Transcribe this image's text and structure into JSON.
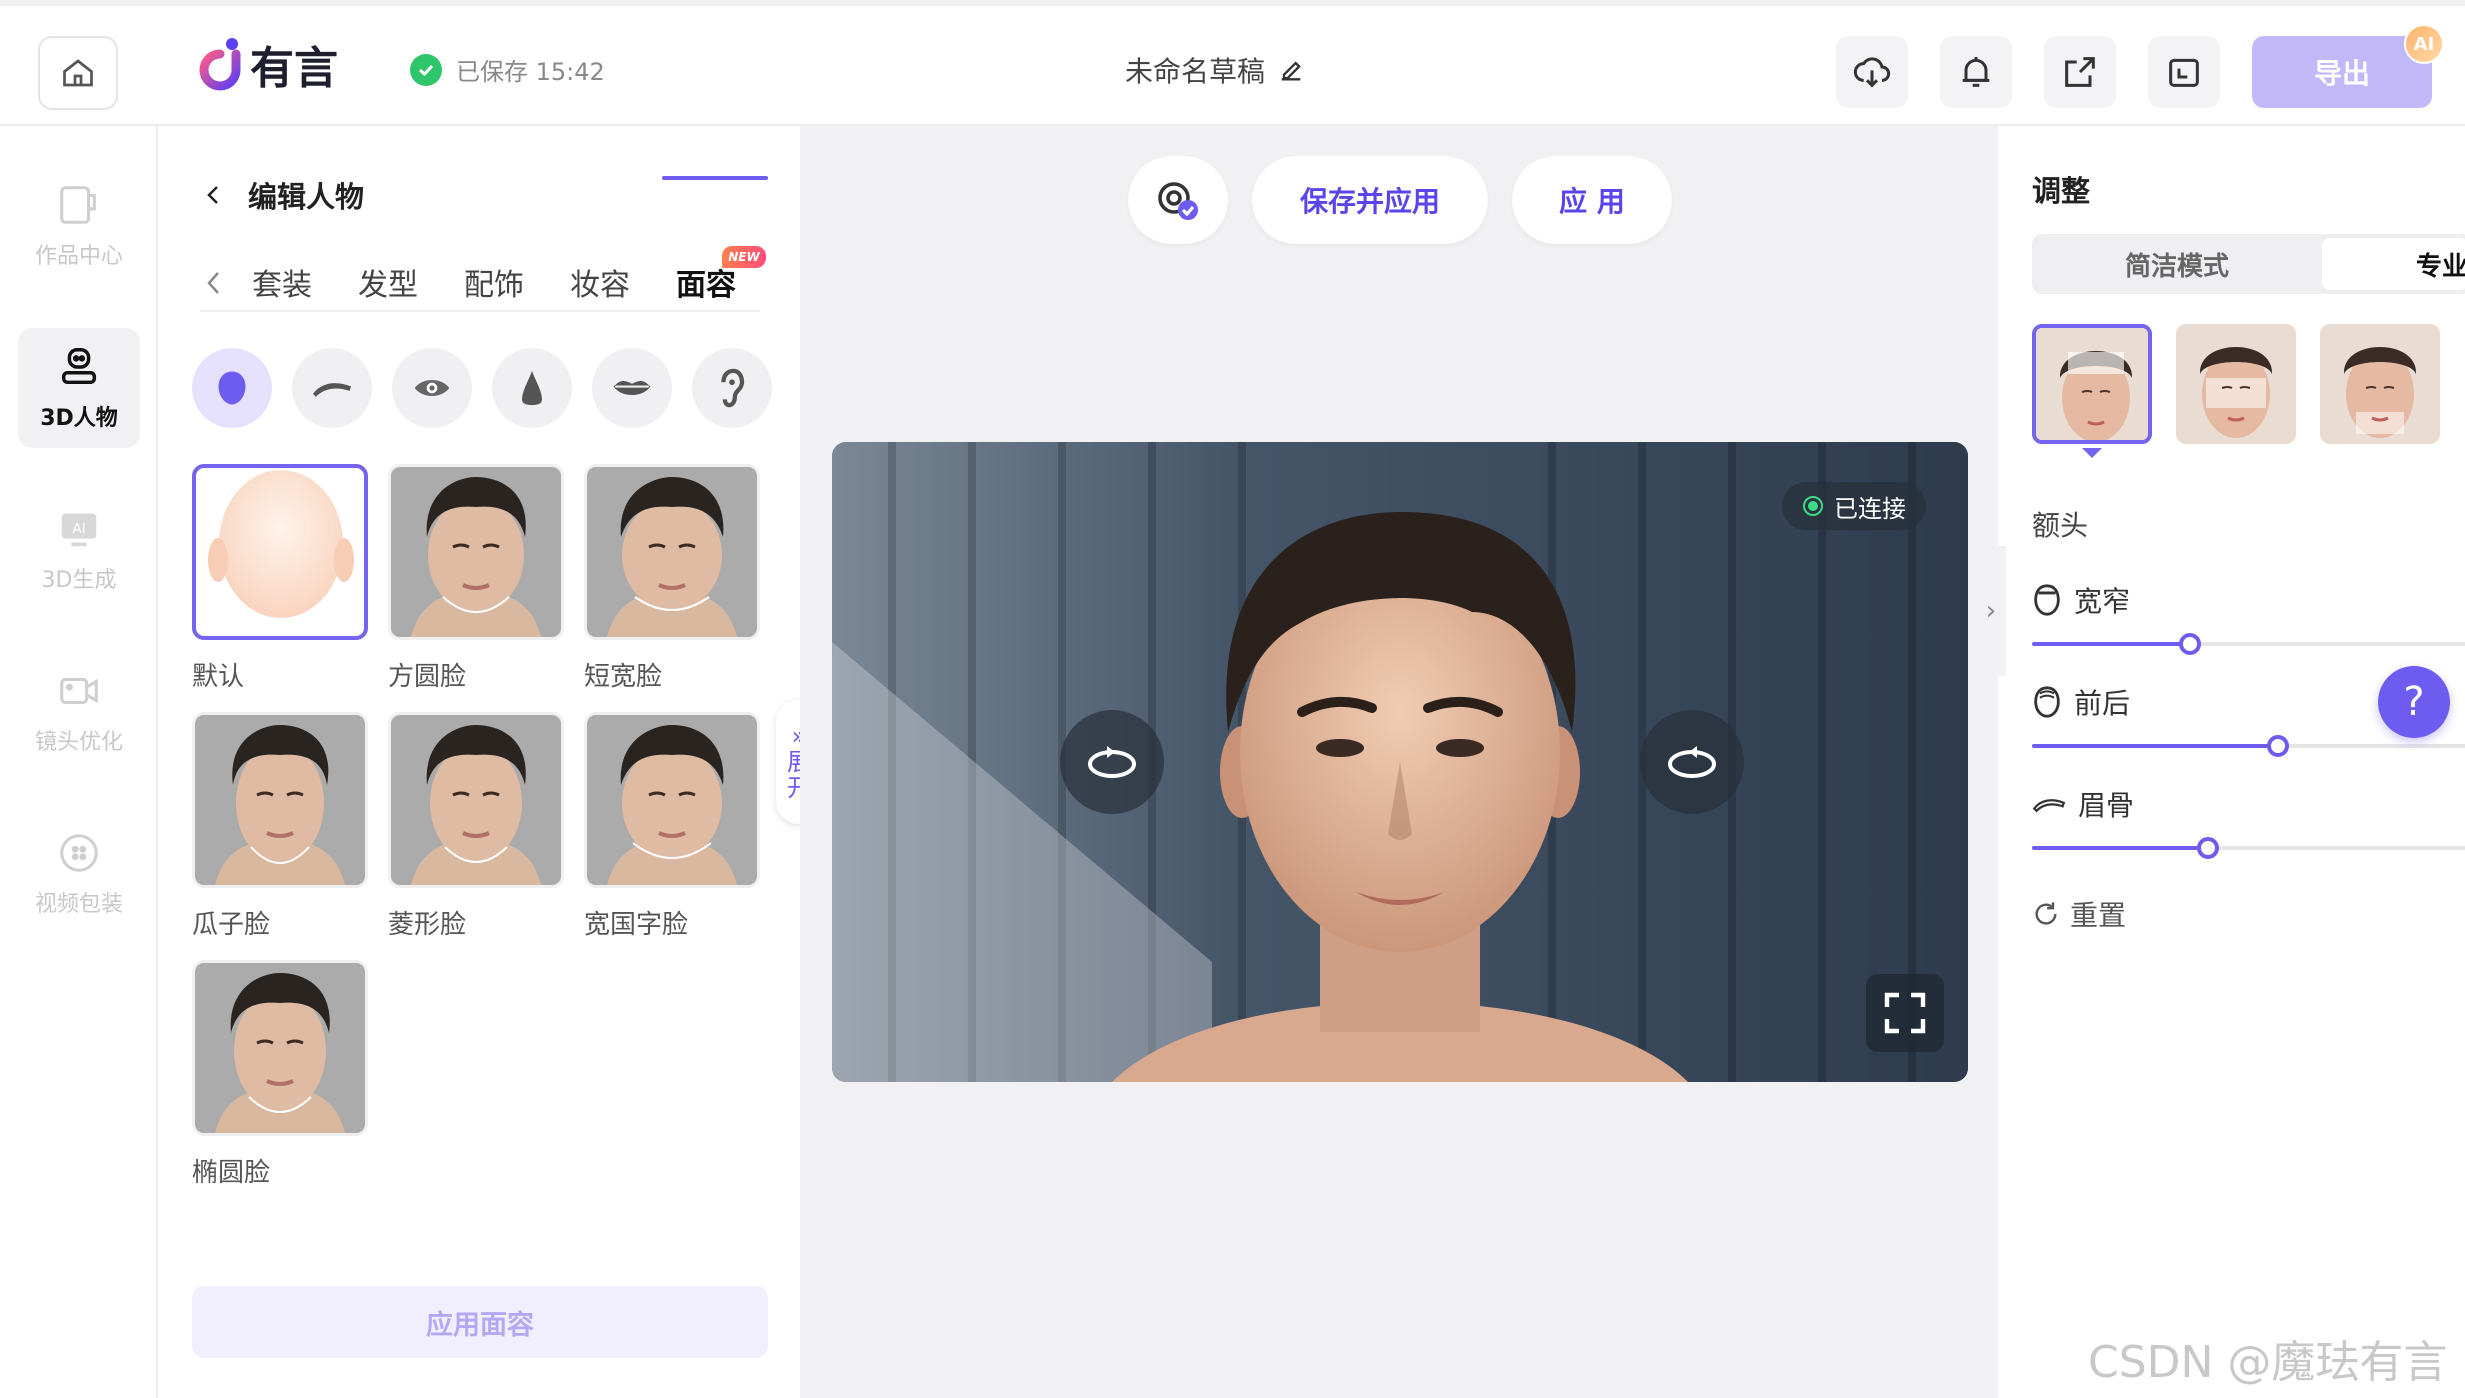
{
  "header": {
    "logo_text": "有言",
    "saved_text": "已保存 15:42",
    "draft_title": "未命名草稿",
    "export_label": "导出",
    "ai_badge": "AI"
  },
  "nav": {
    "items": [
      {
        "label": "作品中心",
        "icon": "works-icon",
        "active": false
      },
      {
        "label": "3D人物",
        "icon": "person-3d-icon",
        "active": true
      },
      {
        "label": "3D生成",
        "icon": "ai-generate-icon",
        "active": false
      },
      {
        "label": "镜头优化",
        "icon": "camera-icon",
        "active": false
      },
      {
        "label": "视频包装",
        "icon": "video-pack-icon",
        "active": false
      }
    ]
  },
  "edit_panel": {
    "title": "编辑人物",
    "tabs": [
      "套装",
      "发型",
      "配饰",
      "妆容",
      "面容"
    ],
    "active_tab": "面容",
    "new_badge": "NEW",
    "features": [
      "face-shape-icon",
      "eyebrow-icon",
      "eye-icon",
      "nose-icon",
      "lips-icon",
      "ear-icon"
    ],
    "faces": [
      {
        "label": "默认",
        "active": true
      },
      {
        "label": "方圆脸",
        "active": false
      },
      {
        "label": "短宽脸",
        "active": false
      },
      {
        "label": "瓜子脸",
        "active": false
      },
      {
        "label": "菱形脸",
        "active": false
      },
      {
        "label": "宽国字脸",
        "active": false
      },
      {
        "label": "椭圆脸",
        "active": false
      }
    ],
    "apply_label": "应用面容",
    "expand_label_1": "展",
    "expand_label_2": "开"
  },
  "canvas": {
    "save_apply_label": "保存并应用",
    "apply_label": "应 用",
    "connected_label": "已连接"
  },
  "right_panel": {
    "title": "调整",
    "modes": [
      "简洁模式",
      "专业"
    ],
    "section": "额头",
    "params": [
      {
        "label": "宽窄",
        "value": 0.36
      },
      {
        "label": "前后",
        "value": 0.56
      },
      {
        "label": "眉骨",
        "value": 0.4
      }
    ],
    "reset_label": "重置",
    "help_label": "?"
  },
  "watermark": "CSDN @魔珐有言",
  "colors": {
    "accent": "#6e5cf0",
    "export_bg": "#c3b8f7",
    "saved_green": "#2fc66b"
  }
}
